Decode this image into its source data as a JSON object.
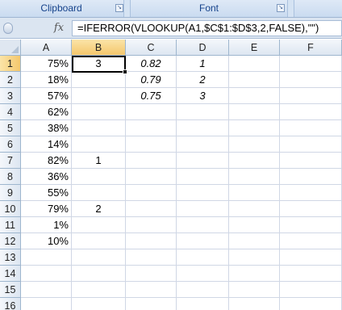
{
  "ribbon": {
    "groups": [
      "Clipboard",
      "Font"
    ]
  },
  "formula_bar": {
    "fx_label": "fx",
    "formula": "=IFERROR(VLOOKUP(A1,$C$1:$D$3,2,FALSE),\"\")"
  },
  "grid": {
    "columns": [
      "A",
      "B",
      "C",
      "D",
      "E",
      "F"
    ],
    "rows": [
      "1",
      "2",
      "3",
      "4",
      "5",
      "6",
      "7",
      "8",
      "9",
      "10",
      "11",
      "12",
      "13",
      "14",
      "15",
      "16"
    ],
    "selected_cell": "B1",
    "cells": {
      "A": [
        "75%",
        "18%",
        "57%",
        "62%",
        "38%",
        "14%",
        "82%",
        "36%",
        "55%",
        "79%",
        "1%",
        "10%",
        "",
        "",
        "",
        ""
      ],
      "B": [
        "3",
        "",
        "",
        "",
        "",
        "",
        "1",
        "",
        "",
        "2",
        "",
        "",
        "",
        "",
        "",
        ""
      ],
      "C": [
        "0.82",
        "0.79",
        "0.75",
        "",
        "",
        "",
        "",
        "",
        "",
        "",
        "",
        "",
        "",
        "",
        "",
        ""
      ],
      "D": [
        "1",
        "2",
        "3",
        "",
        "",
        "",
        "",
        "",
        "",
        "",
        "",
        "",
        "",
        "",
        "",
        ""
      ]
    }
  }
}
